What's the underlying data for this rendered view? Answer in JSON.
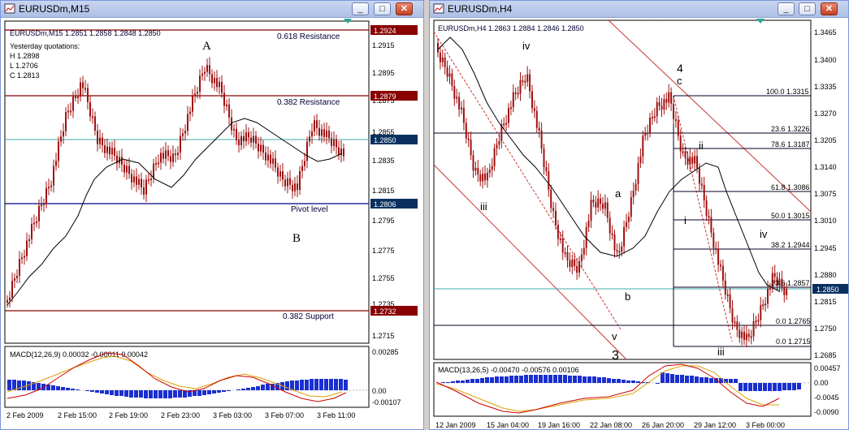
{
  "left": {
    "title": "EURUSDm,M15",
    "info": "EURUSDm,M15  1.2851 1.2858 1.2848 1.2850",
    "yesterday": [
      "Yesterday quotations:",
      "H 1.2898",
      "L 1.2706",
      "C 1.2813"
    ],
    "annotations": {
      "a": "A",
      "b": "B",
      "res618": "0.618 Resistance",
      "res382": "0.382 Resistance",
      "pivot": "Pivot level",
      "sup382": "0.382 Support"
    },
    "boxes": {
      "top": "1.2924",
      "res": "1.2879",
      "cur": "1.2850",
      "pivot": "1.2806",
      "sup": "1.2732"
    },
    "yticks": [
      "1.2915",
      "1.2895",
      "1.2875",
      "1.2855",
      "1.2835",
      "1.2815",
      "1.2795",
      "1.2775",
      "1.2755",
      "1.2735",
      "1.2715"
    ],
    "macd_label": "MACD(12,26,9) 0.00032 -0.00011 0.00042",
    "macd_ticks": [
      "0.00285",
      "0.00",
      "-0.00107"
    ],
    "xticks": [
      "2 Feb 2009",
      "2 Feb 15:00",
      "2 Feb 19:00",
      "2 Feb 23:00",
      "3 Feb 03:00",
      "3 Feb 07:00",
      "3 Feb 11:00"
    ]
  },
  "right": {
    "title": "EURUSDm,H4",
    "info": "EURUSDm,H4  1.2863 1.2884 1.2846 1.2850",
    "waves": {
      "iv_top": "iv",
      "iii_left": "iii",
      "v": "v",
      "three": "3",
      "four": "4",
      "c": "c",
      "a": "a",
      "b": "b",
      "ii": "ii",
      "i": "i",
      "iv_right": "iv",
      "iii_bottom": "iii"
    },
    "fibs": [
      "100.0 1.3315",
      "23.6 1.3226",
      "78.6 1.3187",
      "61.8 1.3086",
      "50.0 1.3015",
      "38.2 1.2944",
      "23.6 1.2857",
      "0.0 1.2765",
      "0.0 1.2715"
    ],
    "cur_box": "1.2850",
    "yticks": [
      "1.3465",
      "1.3400",
      "1.3335",
      "1.3270",
      "1.3205",
      "1.3140",
      "1.3075",
      "1.3010",
      "1.2945",
      "1.2880",
      "1.2815",
      "1.2750",
      "1.2685"
    ],
    "macd_label": "MACD(13,26,5) -0.00470 -0.00576 0.00106",
    "macd_ticks": [
      "0.00457",
      "0.00",
      "-0.0045",
      "-0.0090"
    ],
    "xticks": [
      "12 Jan 2009",
      "15 Jan 04:00",
      "19 Jan 16:00",
      "22 Jan 08:00",
      "26 Jan 20:00",
      "29 Jan 12:00",
      "3 Feb 00:00"
    ]
  }
}
